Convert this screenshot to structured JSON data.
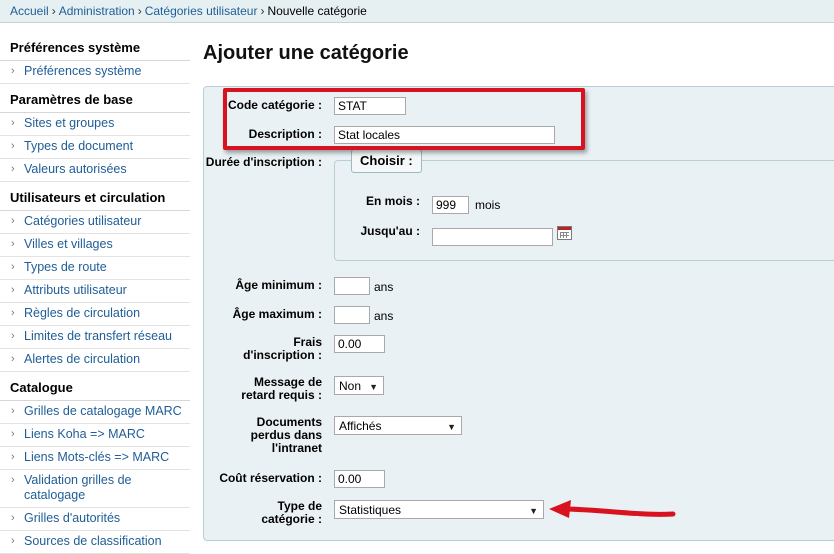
{
  "breadcrumb": {
    "items": [
      "Accueil",
      "Administration",
      "Catégories utilisateur"
    ],
    "current": "Nouvelle catégorie",
    "separator": "›"
  },
  "sidebar": {
    "sections": [
      {
        "title": "Préférences système",
        "items": [
          "Préférences système"
        ]
      },
      {
        "title": "Paramètres de base",
        "items": [
          "Sites et groupes",
          "Types de document",
          "Valeurs autorisées"
        ]
      },
      {
        "title": "Utilisateurs et circulation",
        "items": [
          "Catégories utilisateur",
          "Villes et villages",
          "Types de route",
          "Attributs utilisateur",
          "Règles de circulation",
          "Limites de transfert réseau",
          "Alertes de circulation"
        ]
      },
      {
        "title": "Catalogue",
        "items": [
          "Grilles de catalogage MARC",
          "Liens Koha => MARC",
          "Liens Mots-clés => MARC",
          "Validation grilles de catalogage",
          "Grilles d'autorités",
          "Sources de classification"
        ]
      }
    ]
  },
  "main": {
    "title": "Ajouter une catégorie",
    "form": {
      "code": {
        "label": "Code catégorie :",
        "value": "STAT"
      },
      "description": {
        "label": "Description :",
        "value": "Stat locales"
      },
      "duree": {
        "label": "Durée d'inscription :",
        "legend": "Choisir :",
        "months_label": "En mois :",
        "months_value": "999",
        "months_unit": "mois",
        "until_label": "Jusqu'au :",
        "until_value": ""
      },
      "age_min": {
        "label": "Âge minimum :",
        "value": "",
        "unit": "ans"
      },
      "age_max": {
        "label": "Âge maximum :",
        "value": "",
        "unit": "ans"
      },
      "frais": {
        "label": "Frais d'inscription :",
        "value": "0.00"
      },
      "retard": {
        "label": "Message de retard requis :",
        "value": "Non"
      },
      "documents_perdus": {
        "label": "Documents perdus dans l'intranet",
        "value": "Affichés"
      },
      "cout_reservation": {
        "label": "Coût réservation :",
        "value": "0.00"
      },
      "type_categorie": {
        "label": "Type de catégorie :",
        "value": "Statistiques"
      }
    }
  },
  "icons": {
    "calendar": "calendar-icon",
    "dropdown": "chevron-down-icon",
    "annotation_arrow": "red-arrow-icon"
  },
  "colors": {
    "link": "#1f5d96",
    "annotation": "#d9121f",
    "form_bg": "#e9f1f4"
  }
}
